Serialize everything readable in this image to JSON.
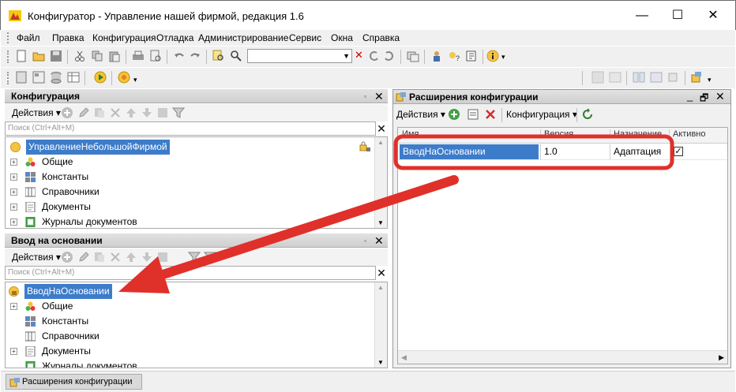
{
  "window": {
    "title": "Конфигуратор - Управление нашей фирмой, редакция 1.6",
    "minimize": "—",
    "maximize": "☐",
    "close": "✕"
  },
  "menu": [
    "Файл",
    "Правка",
    "Конфигурация",
    "Отладка",
    "Администрирование",
    "Сервис",
    "Окна",
    "Справка"
  ],
  "config_panel": {
    "title": "Конфигурация",
    "actions_label": "Действия ▾",
    "search_placeholder": "Поиск (Ctrl+Alt+M)",
    "root": "УправлениеНебольшойФирмой",
    "items": [
      "Общие",
      "Константы",
      "Справочники",
      "Документы",
      "Журналы документов"
    ]
  },
  "basis_panel": {
    "title": "Ввод на основании",
    "actions_label": "Действия ▾",
    "search_placeholder": "Поиск (Ctrl+Alt+M)",
    "root": "ВводНаОсновании",
    "items": [
      "Общие",
      "Константы",
      "Справочники",
      "Документы",
      "Журналы документов"
    ]
  },
  "extensions_window": {
    "title": "Расширения конфигурации",
    "actions_label": "Действия ▾",
    "config_label": "Конфигурация ▾",
    "columns": [
      "Имя",
      "Версия",
      "Назначение",
      "Активно"
    ],
    "rows": [
      {
        "name": "ВводНаОсновании",
        "version": "1.0",
        "purpose": "Адаптация",
        "active": true
      }
    ]
  },
  "statusbar": {
    "tab": "Расширения конфигурации"
  },
  "colors": {
    "selection": "#3d7cc9",
    "annotation": "#e0302a"
  }
}
